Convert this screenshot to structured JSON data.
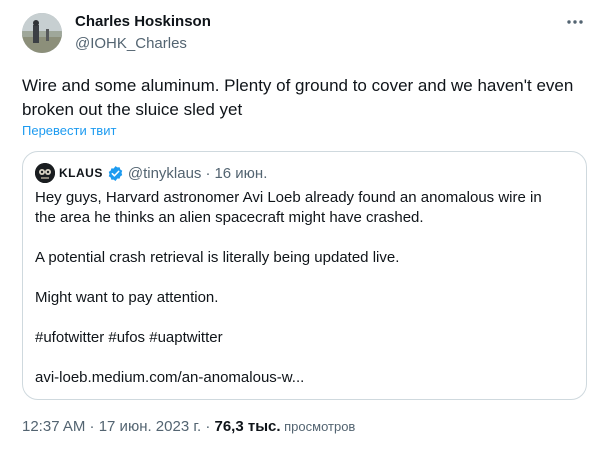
{
  "author": {
    "name": "Charles Hoskinson",
    "handle": "@IOHK_Charles"
  },
  "tweet": {
    "text_line1": "Wire and some aluminum. Plenty of ground to cover and we haven't even",
    "text_line2": "broken out the sluice sled yet",
    "translate_label": "Перевести твит"
  },
  "quote": {
    "name": "KLAUS",
    "handle": "@tinyklaus",
    "separator": "·",
    "date": "16 июн.",
    "line1": "Hey guys, Harvard astronomer Avi Loeb already found an anomalous wire in",
    "line2": "the area he thinks an alien spacecraft might have crashed.",
    "line3": "A potential crash retrieval is literally being updated live.",
    "line4": "Might want to pay attention.",
    "hashtags": "#ufotwitter #ufos #uaptwitter",
    "link": "avi-loeb.medium.com/an-anomalous-w..."
  },
  "meta": {
    "time_date": "12:37 AM · 17 июн. 2023 г. · ",
    "views_count": "76,3 тыс.",
    "views_label": " просмотров"
  },
  "icons": {
    "more": "more-dots-icon",
    "verified": "verified-badge-icon"
  },
  "colors": {
    "link": "#1d9bf0",
    "secondary_text": "#536471",
    "border": "#cfd9de"
  }
}
